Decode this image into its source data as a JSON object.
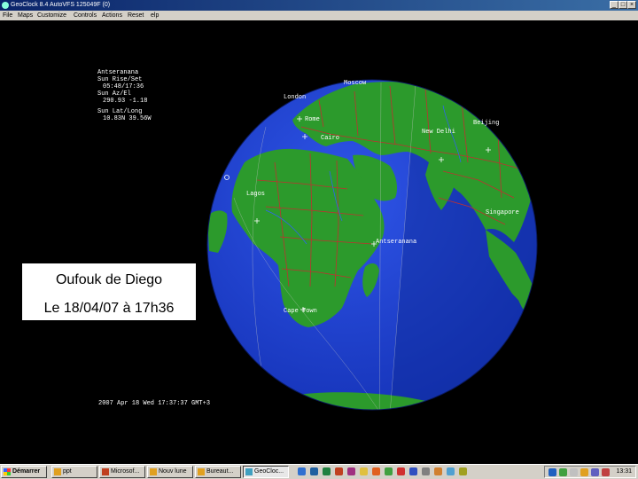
{
  "window": {
    "title": "GeoClock 8.4    AutoVFS 125049F (0)",
    "controls": {
      "minimize": "_",
      "maximize": "□",
      "close": "×"
    }
  },
  "menu": [
    "File",
    "Maps",
    "Customize",
    "Controls",
    "Actions",
    "Reset",
    "elp"
  ],
  "info": {
    "place": "Antseranana",
    "sun_rise_set_label": "Sun Rise/Set",
    "sun_rise_set": "05:48/17:36",
    "sun_az_el_label": "Sun Az/El",
    "sun_az_el": "290.93   -1.18",
    "sun_lat_long_label": "Sun Lat/Long",
    "sun_lat_long": "10.83N   39.56W"
  },
  "map_labels": {
    "moscow": "Moscow",
    "london": "London",
    "rome": "Rome",
    "cairo": "Cairo",
    "beijing": "Beijing",
    "new_delhi": "New Delhi",
    "lagos": "Lagos",
    "singapore": "Singapore",
    "antseranana": "Antseranana",
    "cape_town": "Cape Town"
  },
  "timestamp": "2007 Apr 18 Wed 17:37:37 GMT+3",
  "caption": {
    "line1": "Oufouk de Diego",
    "line2": "Le 18/04/07 à 17h36"
  },
  "taskbar": {
    "start": "Démarrer",
    "tasks": [
      "ppt",
      "Microsof...",
      "Nouv lune",
      "Bureaut...",
      "GeoCloc..."
    ],
    "clock": "13:31"
  },
  "colors": {
    "ocean": "#1a3fd0",
    "land": "#2c9a2c",
    "night": "#0d2a96",
    "borders": "#c03030",
    "titlebar": "#0a246a",
    "caption_bg": "#ffffff"
  }
}
